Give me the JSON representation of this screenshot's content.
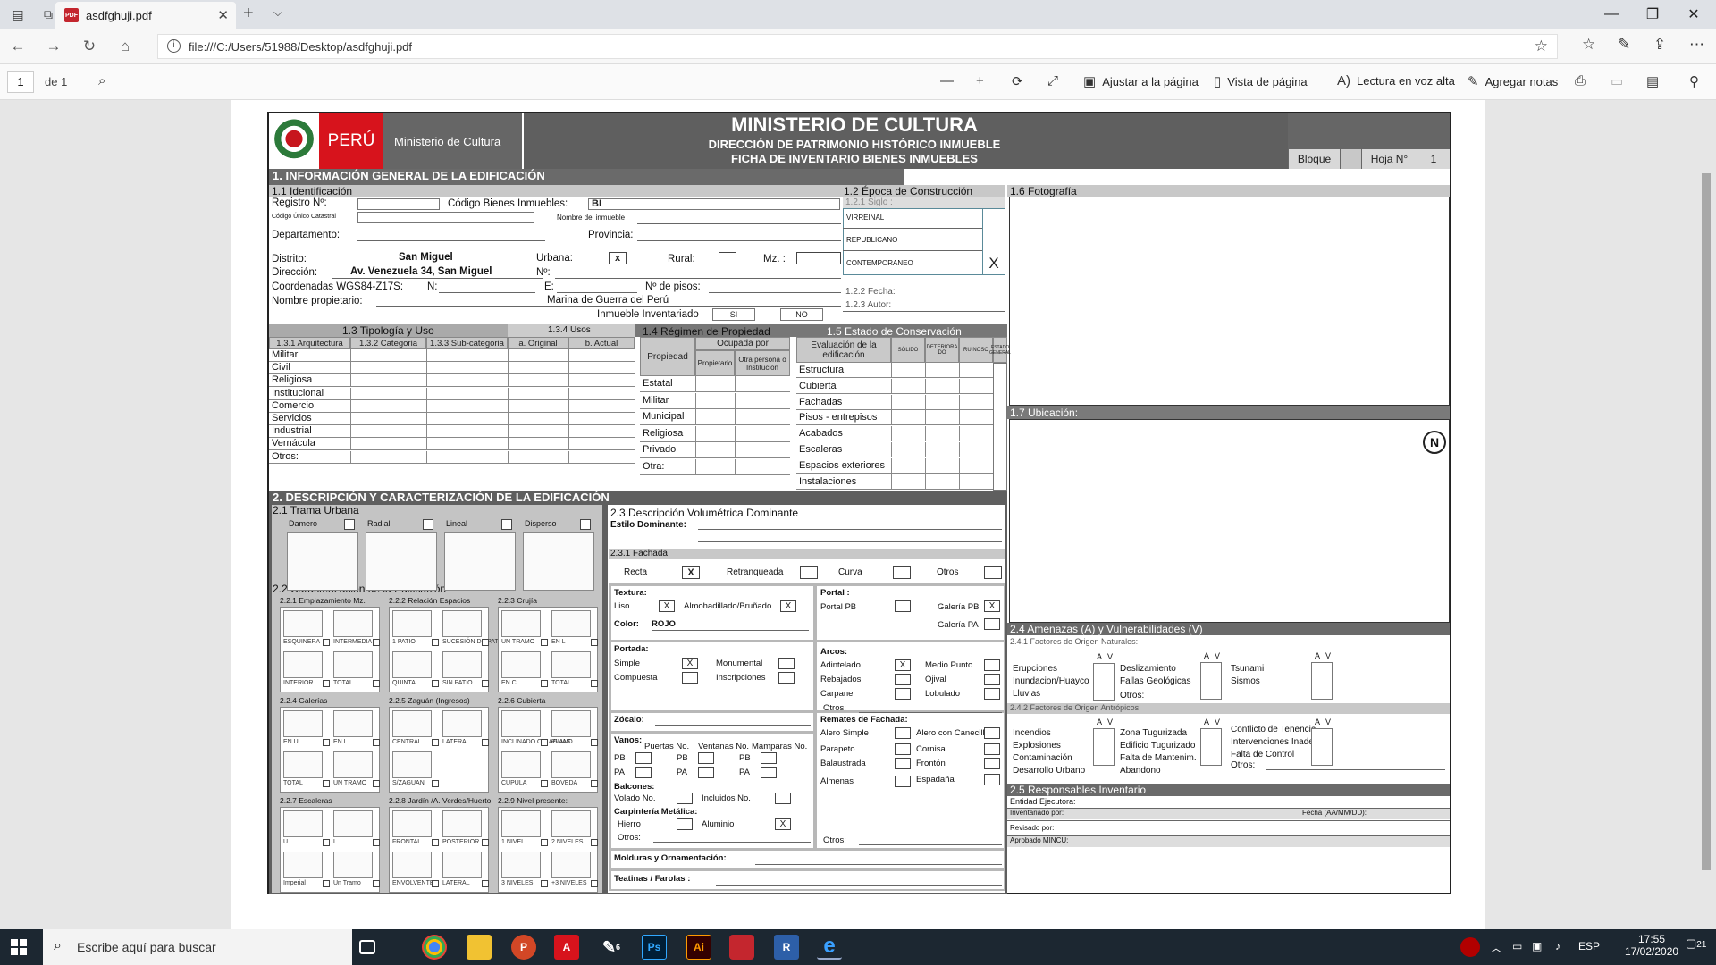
{
  "browser": {
    "tab_title": "asdfghuji.pdf",
    "url": "file:///C:/Users/51988/Desktop/asdfghuji.pdf"
  },
  "pdf_toolbar": {
    "page_current": "1",
    "page_total": "de 1",
    "fit": "Ajustar a la página",
    "view": "Vista de página",
    "read": "Lectura en voz alta",
    "notes": "Agregar notas"
  },
  "form": {
    "header": {
      "brand": "PERÚ",
      "ministry_small": "Ministerio de Cultura",
      "title": "MINISTERIO DE CULTURA",
      "subtitle1": "DIRECCIÓN DE PATRIMONIO HISTÓRICO INMUEBLE",
      "subtitle2": "FICHA DE INVENTARIO BIENES INMUEBLES",
      "bloque": "Bloque",
      "hoja": "Hoja N°",
      "hoja_value": "1"
    },
    "s1": {
      "title": "1. INFORMACIÓN GENERAL DE LA EDIFICACIÓN",
      "ident": "1.1 Identificación",
      "registro": "Registro Nº:",
      "codigo_bienes": "Código Bienes Inmuebles:",
      "codigo_prefix": "BI",
      "catastral": "Código Único Catastral",
      "nombre_inmueble": "Nombre del inmueble",
      "departamento": "Departamento:",
      "provincia": "Provincia:",
      "distrito": "Distrito:",
      "distrito_val": "San Miguel",
      "urbana": "Urbana:",
      "urbana_mark": "x",
      "rural": "Rural:",
      "mz": "Mz. :",
      "direccion": "Dirección:",
      "direccion_val": "Av. Venezuela 34, San Miguel",
      "numero": "Nº:",
      "coordenadas": "Coordenadas WGS84-Z17S:",
      "n": "N:",
      "e": "E:",
      "pisos": "Nº de pisos:",
      "propietario": "Nombre propietario:",
      "propietario_val": "Marina de Guerra del Perú",
      "inventariado": "Inmueble Inventariado",
      "si": "SI",
      "no": "NO",
      "epoca": "1.2 Época de Construcción",
      "siglo": "1.2.1 Siglo :",
      "virreinal": "VIRREINAL",
      "republicano": "REPUBLICANO",
      "contemporaneo": "CONTEMPORANEO",
      "contemporaneo_mark": "X",
      "fecha": "1.2.2 Fecha:",
      "autor": "1.2.3 Autor:",
      "foto": "1.6 Fotografía",
      "ubicacion": "1.7 Ubicación:",
      "north": "N",
      "tipologia": "1.3 Tipología y Uso",
      "usos": "1.3.4 Usos",
      "arq": "1.3.1 Arquitectura",
      "cat": "1.3.2 Categoria",
      "subcat": "1.3.3 Sub-categoria",
      "original": "a. Original",
      "actual": "b. Actual",
      "tipos": [
        "Militar",
        "Civil",
        "Religiosa",
        "Institucional",
        "Comercio",
        "Servicios",
        "Industrial",
        "Vernácula",
        "Otros:"
      ],
      "regimen": "1.4 Régimen de Propiedad",
      "propiedad": "Propiedad",
      "ocupada": "Ocupada por",
      "propietario_col": "Propietario",
      "otra_persona": "Otra persona o Institución",
      "regimen_rows": [
        "Estatal",
        "Militar",
        "Municipal",
        "Religiosa",
        "Privado",
        "Otra:"
      ],
      "estado": "1.5  Estado de Conservación",
      "evaluacion": "Evaluación de la edificación",
      "solido": "SÓLIDO",
      "deteriorado": "DETERIORA DO",
      "ruinoso": "RUINOSO",
      "estado_general": "ESTADO GENERAL",
      "estado_rows": [
        "Estructura",
        "Cubierta",
        "Fachadas",
        "Pisos - entrepisos",
        "Acabados",
        "Escaleras",
        "Espacios exteriores",
        "Instalaciones"
      ]
    },
    "s2": {
      "title": "2. DESCRIPCIÓN Y CARACTERIZACIÓN DE LA EDIFICACIÓN",
      "trama": "2.1 Trama Urbana",
      "damero": "Damero",
      "radial": "Radial",
      "lineal": "Lineal",
      "disperso": "Disperso",
      "caract": "2.2 Caracterización de la Edificación",
      "emplazamiento": "2.2.1 Emplazamiento Mz.",
      "relacion": "2.2.2 Relación Espacios",
      "crujia": "2.2.3 Crujía",
      "galerias": "2.2.4 Galerías",
      "zaguan": "2.2.5 Zaguán (Ingresos)",
      "cubierta": "2.2.6 Cubierta",
      "escaleras": "2.2.7 Escaleras",
      "jardin": "2.2.8  Jardín /A. Verdes/Huerto",
      "nivel": "2.2.9 Nivel presente:",
      "empl_labels": [
        "ESQUINERA",
        "INTERMEDIA",
        "INTERIOR",
        "TOTAL"
      ],
      "rel_labels": [
        "1 PATIO",
        "SUCESIÓN DE PATIOS",
        "QUINTA",
        "SIN PATIO"
      ],
      "cruj_labels": [
        "UN TRAMO",
        "EN L",
        "EN C",
        "TOTAL"
      ],
      "gal_labels": [
        "EN U",
        "EN L",
        "TOTAL",
        "UN TRAMO"
      ],
      "zag_labels": [
        "CENTRAL",
        "LATERAL",
        "S/ZAGUAN"
      ],
      "cub_labels": [
        "INCLINADO O 4 AGUAS",
        "PLANO",
        "CUPULA",
        "BOVEDA"
      ],
      "esc_labels": [
        "U",
        "L",
        "Imperial",
        "Un Tramo"
      ],
      "jar_labels": [
        "FRONTAL",
        "POSTERIOR",
        "ENVOLVENTE",
        "LATERAL"
      ],
      "niv_labels": [
        "1 NIVEL",
        "2 NIVELES",
        "3 NIVELES",
        "+3 NIVELES"
      ],
      "volumetrica": "2.3 Descripción Volumétrica Dominante",
      "estilo": "Estilo Dominante:",
      "fachada": "2.3.1 Fachada",
      "recta": "Recta",
      "recta_mark": "X",
      "retranqueada": "Retranqueada",
      "curva": "Curva",
      "otros": "Otros",
      "textura": "Textura:",
      "liso": "Liso",
      "liso_mark": "X",
      "almohadillado": "Almohadillado/Bruñado",
      "almohadillado_mark": "X",
      "color": "Color:",
      "color_val": "ROJO",
      "portal": "Portal :",
      "portal_pb": "Portal PB",
      "galeria_pb": "Galería PB",
      "galeria_pb_mark": "X",
      "galeria_pa": "Galería PA",
      "portada": "Portada:",
      "simple": "Simple",
      "simple_mark": "X",
      "monumental": "Monumental",
      "compuesta": "Compuesta",
      "inscripciones": "Inscripciones",
      "arcos": "Arcos:",
      "adintelado": "Adintelado",
      "adintelado_mark": "X",
      "medio_punto": "Medio Punto",
      "rebajados": "Rebajados",
      "ojival": "Ojival",
      "carpanel": "Carpanel",
      "lobulado": "Lobulado",
      "otros2": "Otros:",
      "zocalo": "Zócalo:",
      "vanos": "Vanos:",
      "puertas": "Puertas No.",
      "ventanas": "Ventanas No.",
      "mamparas": "Mamparas No.",
      "pb": "PB",
      "pa": "PA",
      "balcones": "Balcones:",
      "volado": "Volado No.",
      "incluidos": "Incluidos No.",
      "carpinteria": "Carpintería Metálica:",
      "hierro": "Hierro",
      "aluminio": "Aluminio",
      "aluminio_mark": "X",
      "remates": "Remates de Fachada:",
      "alero_simple": "Alero Simple",
      "alero_canecillos": "Alero con Canecillos",
      "parapeto": "Parapeto",
      "cornisa": "Cornisa",
      "balaustrada": "Balaustrada",
      "fronton": "Frontón",
      "almenas": "Almenas",
      "espadana": "Espadaña",
      "molduras": "Molduras y Ornamentación:",
      "teatinas": "Teatinas / Farolas :",
      "amenazas": "2.4 Amenazas (A) y  Vulnerabilidades (V)",
      "nat": "2.4.1  Factores de Origen Naturales:",
      "antro": "2.4.2 Factores de Origen Antrópicos",
      "a": "A",
      "v": "V",
      "nat1": [
        "Erupciones",
        "Inundacion/Huayco",
        "Lluvias"
      ],
      "nat2": [
        "Deslizamiento",
        "Fallas Geológicas"
      ],
      "nat3": [
        "Tsunami",
        "Sismos"
      ],
      "ant1": [
        "Incendios",
        "Explosiones",
        "Contaminación",
        "Desarrollo Urbano"
      ],
      "ant2": [
        "Zona Tugurizada",
        "Edificio Tugurizado",
        "Falta de Mantenim.",
        "Abandono"
      ],
      "ant3": [
        "Conflicto de Tenencia",
        "Intervenciones Inadec.",
        "Falta de Control"
      ],
      "responsables": "2.5 Responsables Inventario",
      "entidad": "Entidad Ejecutora:",
      "inventariado_por": "Inventariado por:",
      "fecha_aa": "Fecha (AA/MM/DD):",
      "revisado": "Revisado por:",
      "aprobado": "Aprobado MINCU:"
    }
  },
  "taskbar": {
    "search_placeholder": "Escribe aquí para buscar",
    "lang": "ESP",
    "time": "17:55",
    "date": "17/02/2020",
    "notifications": "21",
    "badge": "6"
  }
}
